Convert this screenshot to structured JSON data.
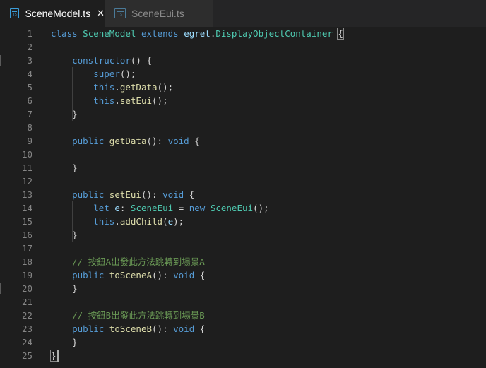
{
  "tabs": [
    {
      "label": "SceneModel.ts",
      "close": "✕",
      "active": true
    },
    {
      "label": "SceneEui.ts",
      "active": false
    }
  ],
  "editor": {
    "language": "typescript",
    "lines": [
      {
        "n": "1",
        "tokens": [
          [
            "kw",
            "class"
          ],
          [
            "txt",
            " "
          ],
          [
            "cls",
            "SceneModel"
          ],
          [
            "txt",
            " "
          ],
          [
            "kw",
            "extends"
          ],
          [
            "txt",
            " "
          ],
          [
            "var",
            "egret"
          ],
          [
            "txt",
            "."
          ],
          [
            "cls",
            "DisplayObjectContainer"
          ],
          [
            "txt",
            " "
          ],
          [
            "brace",
            "{"
          ]
        ]
      },
      {
        "n": "2",
        "tokens": []
      },
      {
        "n": "3",
        "tokens": [
          [
            "txt",
            "    "
          ],
          [
            "kw",
            "constructor"
          ],
          [
            "txt",
            "() {"
          ]
        ]
      },
      {
        "n": "4",
        "tokens": [
          [
            "txt",
            "        "
          ],
          [
            "kw",
            "super"
          ],
          [
            "txt",
            "();"
          ]
        ]
      },
      {
        "n": "5",
        "tokens": [
          [
            "txt",
            "        "
          ],
          [
            "kw",
            "this"
          ],
          [
            "txt",
            "."
          ],
          [
            "fn",
            "getData"
          ],
          [
            "txt",
            "();"
          ]
        ]
      },
      {
        "n": "6",
        "tokens": [
          [
            "txt",
            "        "
          ],
          [
            "kw",
            "this"
          ],
          [
            "txt",
            "."
          ],
          [
            "fn",
            "setEui"
          ],
          [
            "txt",
            "();"
          ]
        ]
      },
      {
        "n": "7",
        "tokens": [
          [
            "txt",
            "    }"
          ]
        ]
      },
      {
        "n": "8",
        "tokens": []
      },
      {
        "n": "9",
        "tokens": [
          [
            "txt",
            "    "
          ],
          [
            "kw",
            "public"
          ],
          [
            "txt",
            " "
          ],
          [
            "fn",
            "getData"
          ],
          [
            "txt",
            "(): "
          ],
          [
            "kw",
            "void"
          ],
          [
            "txt",
            " {"
          ]
        ]
      },
      {
        "n": "10",
        "tokens": []
      },
      {
        "n": "11",
        "tokens": [
          [
            "txt",
            "    }"
          ]
        ]
      },
      {
        "n": "12",
        "tokens": []
      },
      {
        "n": "13",
        "tokens": [
          [
            "txt",
            "    "
          ],
          [
            "kw",
            "public"
          ],
          [
            "txt",
            " "
          ],
          [
            "fn",
            "setEui"
          ],
          [
            "txt",
            "(): "
          ],
          [
            "kw",
            "void"
          ],
          [
            "txt",
            " {"
          ]
        ]
      },
      {
        "n": "14",
        "tokens": [
          [
            "txt",
            "        "
          ],
          [
            "kw",
            "let"
          ],
          [
            "txt",
            " "
          ],
          [
            "var",
            "e"
          ],
          [
            "txt",
            ": "
          ],
          [
            "cls",
            "SceneEui"
          ],
          [
            "txt",
            " = "
          ],
          [
            "kw",
            "new"
          ],
          [
            "txt",
            " "
          ],
          [
            "cls",
            "SceneEui"
          ],
          [
            "txt",
            "();"
          ]
        ]
      },
      {
        "n": "15",
        "tokens": [
          [
            "txt",
            "        "
          ],
          [
            "kw",
            "this"
          ],
          [
            "txt",
            "."
          ],
          [
            "fn",
            "addChild"
          ],
          [
            "txt",
            "("
          ],
          [
            "var",
            "e"
          ],
          [
            "txt",
            ");"
          ]
        ]
      },
      {
        "n": "16",
        "tokens": [
          [
            "txt",
            "    }"
          ]
        ]
      },
      {
        "n": "17",
        "tokens": []
      },
      {
        "n": "18",
        "tokens": [
          [
            "txt",
            "    "
          ],
          [
            "cmt",
            "// 按鈕A出發此方法跳轉到場景A"
          ]
        ]
      },
      {
        "n": "19",
        "tokens": [
          [
            "txt",
            "    "
          ],
          [
            "kw",
            "public"
          ],
          [
            "txt",
            " "
          ],
          [
            "fn",
            "toSceneA"
          ],
          [
            "txt",
            "(): "
          ],
          [
            "kw",
            "void"
          ],
          [
            "txt",
            " {"
          ]
        ]
      },
      {
        "n": "20",
        "tokens": [
          [
            "txt",
            "    }"
          ]
        ]
      },
      {
        "n": "21",
        "tokens": []
      },
      {
        "n": "22",
        "tokens": [
          [
            "txt",
            "    "
          ],
          [
            "cmt",
            "// 按鈕B出發此方法跳轉到場景B"
          ]
        ]
      },
      {
        "n": "23",
        "tokens": [
          [
            "txt",
            "    "
          ],
          [
            "kw",
            "public"
          ],
          [
            "txt",
            " "
          ],
          [
            "fn",
            "toSceneB"
          ],
          [
            "txt",
            "(): "
          ],
          [
            "kw",
            "void"
          ],
          [
            "txt",
            " {"
          ]
        ]
      },
      {
        "n": "24",
        "tokens": [
          [
            "txt",
            "    }"
          ]
        ]
      },
      {
        "n": "25",
        "tokens": [
          [
            "brace",
            "}"
          ]
        ]
      }
    ]
  },
  "colors": {
    "background": "#1e1e1e",
    "keyword": "#569cd6",
    "function": "#dcdcaa",
    "class": "#4ec9b0",
    "variable": "#9cdcfe",
    "comment": "#6a9955",
    "text": "#d4d4d4",
    "line_number": "#858585"
  }
}
